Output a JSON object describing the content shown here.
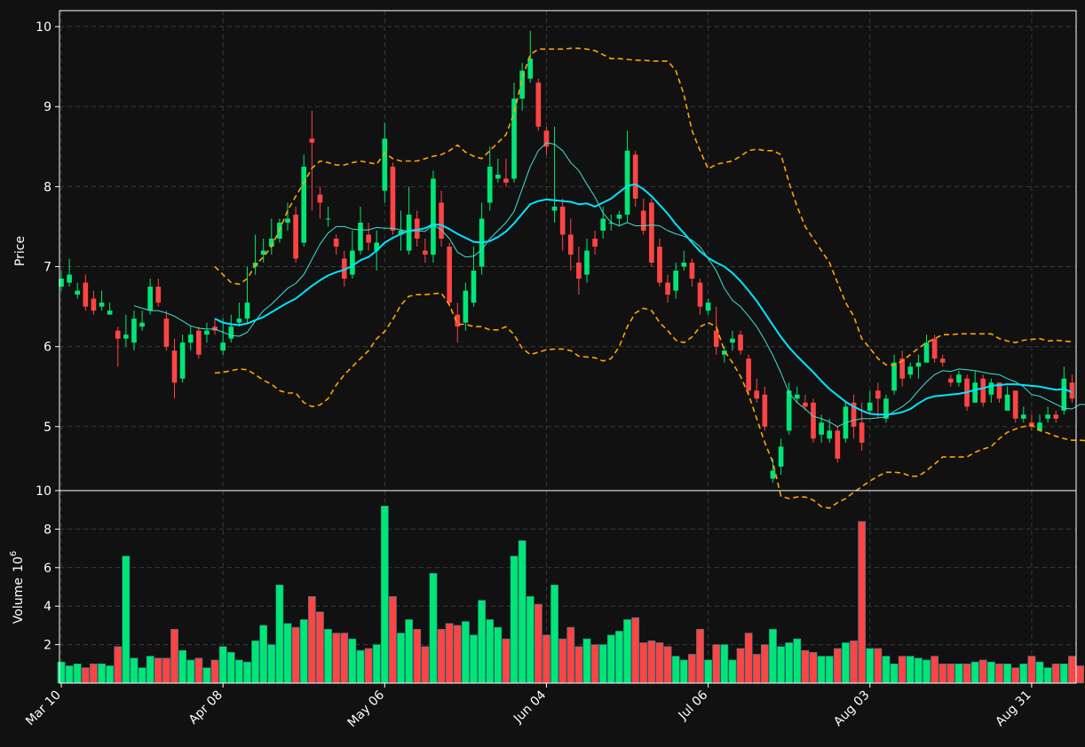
{
  "colors": {
    "background": "#111111",
    "up": "#00e676",
    "down": "#ff4444",
    "ma_slow": "#00e5ff",
    "ma_fast": "#40e0d0",
    "bands": "#ffa500",
    "grid": "#3a3a3a",
    "axis": "#ffffff"
  },
  "chart_data": [
    {
      "type": "candlestick",
      "panel": "price",
      "ylabel": "Price",
      "ylim": [
        4.2,
        10.2
      ],
      "yticks": [
        5,
        6,
        7,
        8,
        9,
        10
      ],
      "ytick_labels": [
        "5",
        "6",
        "7",
        "8",
        "9",
        "10"
      ],
      "x_dates": [
        "Mar 10",
        "Apr 08",
        "May 06",
        "Jun 04",
        "Jul 06",
        "Aug 03",
        "Aug 31"
      ],
      "x_index": [
        0,
        20,
        40,
        60,
        80,
        100,
        120
      ],
      "grid": true,
      "close": [
        6.85,
        6.9,
        6.7,
        6.5,
        6.45,
        6.55,
        6.45,
        6.1,
        6.15,
        6.35,
        6.3,
        6.75,
        6.55,
        6.0,
        5.55,
        6.05,
        6.15,
        5.9,
        6.2,
        6.2,
        6.05,
        6.25,
        6.35,
        6.55,
        7.05,
        7.2,
        7.35,
        7.55,
        7.6,
        7.1,
        8.25,
        8.55,
        7.8,
        7.6,
        7.25,
        6.85,
        7.2,
        7.55,
        7.3,
        7.3,
        8.6,
        7.45,
        7.45,
        7.65,
        7.35,
        7.15,
        8.1,
        7.35,
        6.55,
        6.25,
        6.7,
        6.95,
        7.6,
        8.25,
        8.15,
        8.05,
        9.1,
        9.45,
        9.6,
        8.75,
        8.5,
        7.75,
        7.4,
        7.15,
        6.85,
        7.2,
        7.25,
        7.6,
        7.55,
        7.65,
        8.45,
        7.85,
        7.45,
        7.05,
        6.8,
        6.65,
        6.95,
        7.05,
        6.85,
        6.5,
        6.55,
        6.0,
        5.95,
        6.1,
        5.95,
        5.45,
        5.35,
        5.0,
        4.45,
        4.75,
        5.45,
        5.4,
        5.25,
        4.85,
        5.05,
        4.95,
        4.6,
        5.25,
        5.0,
        4.8,
        5.3,
        5.35,
        5.35,
        5.8,
        5.6,
        5.75,
        5.8,
        6.05,
        5.85,
        5.8,
        5.55,
        5.65,
        5.25,
        5.55,
        5.3,
        5.55,
        5.35,
        5.4,
        5.1,
        5.15,
        5.0,
        5.05,
        5.15,
        5.1,
        5.6,
        5.35
      ],
      "open": [
        6.75,
        6.8,
        6.65,
        6.8,
        6.6,
        6.5,
        6.4,
        6.2,
        6.1,
        6.05,
        6.25,
        6.45,
        6.75,
        6.35,
        5.95,
        5.6,
        6.05,
        6.2,
        6.15,
        6.25,
        5.95,
        6.1,
        6.3,
        6.35,
        7.0,
        7.15,
        7.25,
        7.35,
        7.55,
        7.65,
        7.3,
        8.6,
        7.9,
        7.6,
        7.35,
        7.1,
        6.9,
        7.2,
        7.4,
        7.2,
        7.95,
        8.25,
        7.4,
        7.2,
        7.6,
        7.2,
        7.15,
        7.8,
        7.25,
        6.4,
        6.3,
        6.55,
        7.0,
        7.8,
        8.1,
        8.1,
        8.1,
        9.1,
        9.35,
        9.3,
        8.7,
        7.7,
        7.75,
        7.4,
        7.05,
        6.9,
        7.35,
        7.45,
        7.55,
        7.6,
        7.65,
        8.4,
        7.7,
        7.8,
        7.25,
        6.8,
        6.7,
        7.0,
        7.05,
        6.8,
        6.45,
        6.2,
        5.9,
        6.05,
        6.15,
        5.85,
        5.45,
        5.4,
        4.35,
        4.5,
        4.95,
        5.35,
        5.3,
        5.3,
        4.9,
        4.85,
        4.95,
        4.85,
        5.3,
        5.05,
        5.2,
        5.45,
        5.1,
        5.45,
        5.85,
        5.65,
        5.75,
        5.8,
        6.1,
        5.85,
        5.6,
        5.55,
        5.6,
        5.3,
        5.6,
        5.4,
        5.55,
        5.2,
        5.45,
        5.1,
        5.05,
        4.95,
        5.1,
        5.15,
        5.2,
        5.55
      ],
      "high": [
        6.95,
        7.1,
        6.8,
        6.9,
        6.7,
        6.7,
        6.55,
        6.25,
        6.4,
        6.45,
        6.45,
        6.85,
        6.85,
        6.45,
        6.1,
        6.15,
        6.25,
        6.25,
        6.3,
        6.35,
        6.35,
        6.4,
        6.55,
        7.0,
        7.4,
        7.35,
        7.6,
        7.6,
        7.8,
        7.75,
        8.4,
        8.95,
        8.0,
        7.75,
        7.4,
        7.2,
        7.45,
        7.75,
        7.55,
        7.45,
        8.8,
        8.3,
        7.7,
        8.0,
        7.7,
        7.35,
        8.2,
        7.95,
        7.3,
        6.55,
        6.8,
        7.25,
        7.8,
        8.5,
        8.35,
        8.35,
        9.3,
        9.55,
        9.95,
        9.35,
        8.75,
        8.75,
        7.85,
        7.6,
        7.25,
        7.35,
        7.45,
        7.75,
        7.65,
        7.7,
        8.7,
        8.45,
        7.85,
        7.85,
        7.35,
        6.9,
        7.05,
        7.2,
        7.1,
        6.85,
        6.6,
        6.5,
        6.0,
        6.2,
        6.2,
        5.9,
        5.6,
        5.5,
        4.6,
        4.85,
        5.55,
        5.5,
        5.4,
        5.35,
        5.15,
        5.1,
        5.0,
        5.3,
        5.4,
        5.3,
        5.45,
        5.55,
        5.4,
        5.9,
        5.95,
        5.8,
        5.9,
        6.15,
        6.15,
        5.9,
        5.65,
        5.7,
        5.65,
        5.7,
        5.65,
        5.6,
        5.55,
        5.5,
        5.25,
        5.25,
        5.15,
        5.15,
        5.25,
        5.2,
        5.75,
        5.65
      ],
      "low": [
        6.7,
        6.75,
        6.6,
        6.45,
        6.4,
        6.45,
        6.4,
        5.75,
        6.0,
        5.95,
        6.2,
        6.4,
        6.5,
        5.95,
        5.35,
        5.55,
        5.95,
        5.85,
        6.05,
        6.15,
        5.9,
        6.05,
        6.25,
        6.3,
        6.9,
        7.05,
        7.15,
        7.3,
        7.45,
        7.05,
        7.25,
        7.7,
        7.6,
        7.5,
        7.15,
        6.75,
        6.85,
        7.15,
        7.2,
        6.95,
        7.8,
        7.4,
        7.2,
        7.15,
        7.25,
        7.05,
        7.05,
        7.25,
        6.5,
        6.05,
        6.2,
        6.5,
        6.9,
        7.7,
        8.05,
        8.0,
        8.05,
        8.95,
        9.3,
        8.7,
        8.4,
        7.55,
        7.2,
        6.95,
        6.65,
        6.8,
        7.15,
        7.35,
        7.45,
        7.5,
        7.55,
        7.75,
        7.4,
        7.0,
        6.75,
        6.55,
        6.6,
        6.95,
        6.75,
        6.4,
        6.4,
        5.9,
        5.8,
        5.95,
        5.9,
        5.4,
        5.3,
        4.95,
        4.3,
        4.4,
        4.9,
        5.3,
        5.2,
        4.8,
        4.8,
        4.8,
        4.55,
        4.8,
        4.85,
        4.7,
        5.15,
        5.1,
        5.05,
        5.4,
        5.5,
        5.6,
        5.6,
        5.95,
        5.8,
        5.75,
        5.5,
        5.5,
        5.2,
        5.5,
        5.25,
        5.3,
        5.3,
        5.35,
        5.05,
        5.05,
        4.95,
        4.95,
        5.05,
        5.05,
        5.15,
        5.3
      ],
      "ma_slow": [
        null,
        null,
        null,
        null,
        null,
        null,
        null,
        null,
        null,
        null,
        null,
        null,
        null,
        null,
        null,
        null,
        null,
        null,
        null,
        6.35,
        6.3,
        6.28,
        6.27,
        6.29,
        6.33,
        6.37,
        6.43,
        6.49,
        6.55,
        6.6,
        6.68,
        6.76,
        6.83,
        6.89,
        6.93,
        6.96,
        7.01,
        7.08,
        7.12,
        7.2,
        7.3,
        7.36,
        7.41,
        7.45,
        7.46,
        7.48,
        7.53,
        7.52,
        7.47,
        7.41,
        7.36,
        7.31,
        7.3,
        7.32,
        7.37,
        7.44,
        7.54,
        7.66,
        7.78,
        7.82,
        7.84,
        7.83,
        7.82,
        7.81,
        7.78,
        7.79,
        7.75,
        7.8,
        7.85,
        7.93,
        8.01,
        8.03,
        7.97,
        7.88,
        7.77,
        7.66,
        7.53,
        7.42,
        7.3,
        7.19,
        7.11,
        7.05,
        7.0,
        6.92,
        6.82,
        6.7,
        6.57,
        6.42,
        6.27,
        6.12,
        5.99,
        5.88,
        5.78,
        5.68,
        5.57,
        5.47,
        5.39,
        5.31,
        5.25,
        5.2,
        5.16,
        5.15,
        5.15,
        5.16,
        5.18,
        5.22,
        5.29,
        5.35,
        5.38,
        5.39,
        5.4,
        5.41,
        5.43,
        5.46,
        5.48,
        5.51,
        5.52,
        5.53,
        5.53,
        5.52,
        5.51,
        5.5,
        5.48,
        5.46,
        5.47,
        5.43
      ],
      "ma_fast": [
        null,
        null,
        null,
        null,
        null,
        null,
        null,
        null,
        null,
        6.51,
        6.48,
        6.45,
        6.45,
        6.42,
        6.38,
        6.32,
        6.26,
        6.23,
        6.22,
        6.22,
        6.18,
        6.14,
        6.13,
        6.18,
        6.32,
        6.45,
        6.53,
        6.63,
        6.73,
        6.79,
        6.9,
        7.09,
        7.28,
        7.42,
        7.5,
        7.5,
        7.47,
        7.46,
        7.46,
        7.49,
        7.48,
        7.48,
        7.46,
        7.44,
        7.45,
        7.44,
        7.52,
        7.46,
        7.35,
        7.18,
        7.12,
        7.13,
        7.21,
        7.35,
        7.45,
        7.55,
        7.69,
        7.97,
        8.25,
        8.45,
        8.55,
        8.53,
        8.45,
        8.3,
        8.2,
        8.03,
        7.87,
        7.67,
        7.55,
        7.51,
        7.55,
        7.51,
        7.51,
        7.52,
        7.51,
        7.45,
        7.41,
        7.38,
        7.33,
        7.25,
        7.1,
        6.95,
        6.73,
        6.58,
        6.5,
        6.38,
        6.25,
        6.08,
        5.89,
        5.67,
        5.42,
        5.3,
        5.22,
        5.13,
        5.1,
        5.06,
        5.0,
        5.05,
        5.08,
        5.1,
        5.1,
        5.11,
        5.12,
        5.19,
        5.25,
        5.33,
        5.45,
        5.56,
        5.65,
        5.7,
        5.69,
        5.72,
        5.71,
        5.7,
        5.68,
        5.66,
        5.65,
        5.6,
        5.56,
        5.5,
        5.4,
        5.38,
        5.33,
        5.28,
        5.23,
        5.22,
        5.28,
        5.27
      ],
      "band_upper": [
        null,
        null,
        null,
        null,
        null,
        null,
        null,
        null,
        null,
        null,
        null,
        null,
        null,
        null,
        null,
        null,
        null,
        null,
        null,
        7.0,
        6.9,
        6.8,
        6.78,
        6.85,
        7.02,
        7.12,
        7.25,
        7.46,
        7.7,
        7.88,
        8.05,
        8.23,
        8.32,
        8.3,
        8.27,
        8.27,
        8.3,
        8.32,
        8.3,
        8.28,
        8.42,
        8.35,
        8.32,
        8.32,
        8.32,
        8.35,
        8.38,
        8.4,
        8.45,
        8.52,
        8.43,
        8.38,
        8.35,
        8.45,
        8.55,
        8.65,
        8.92,
        9.35,
        9.65,
        9.72,
        9.72,
        9.72,
        9.72,
        9.73,
        9.73,
        9.72,
        9.7,
        9.65,
        9.6,
        9.6,
        9.59,
        9.58,
        9.58,
        9.57,
        9.57,
        9.57,
        9.45,
        9.15,
        8.7,
        8.45,
        8.22,
        8.28,
        8.3,
        8.32,
        8.38,
        8.45,
        8.47,
        8.45,
        8.45,
        8.4,
        8.05,
        7.75,
        7.5,
        7.35,
        7.2,
        7.05,
        6.8,
        6.55,
        6.38,
        6.1,
        5.98,
        5.85,
        5.77,
        5.77,
        5.82,
        5.9,
        5.98,
        6.05,
        6.1,
        6.15,
        6.15,
        6.16,
        6.16,
        6.16,
        6.16,
        6.16,
        6.1,
        6.07,
        6.05,
        6.08,
        6.09,
        6.1,
        6.07,
        6.08,
        6.07,
        6.06
      ],
      "band_lower": [
        null,
        null,
        null,
        null,
        null,
        null,
        null,
        null,
        null,
        null,
        null,
        null,
        null,
        null,
        null,
        null,
        null,
        null,
        null,
        5.67,
        5.68,
        5.7,
        5.72,
        5.71,
        5.65,
        5.58,
        5.53,
        5.45,
        5.42,
        5.42,
        5.3,
        5.25,
        5.27,
        5.35,
        5.52,
        5.65,
        5.75,
        5.85,
        5.95,
        6.1,
        6.19,
        6.34,
        6.52,
        6.63,
        6.65,
        6.65,
        6.66,
        6.67,
        6.52,
        6.28,
        6.28,
        6.25,
        6.25,
        6.21,
        6.21,
        6.25,
        6.15,
        5.98,
        5.9,
        5.93,
        5.96,
        5.97,
        5.97,
        5.95,
        5.88,
        5.87,
        5.86,
        5.82,
        5.85,
        6.0,
        6.25,
        6.42,
        6.48,
        6.45,
        6.3,
        6.2,
        6.08,
        6.05,
        6.12,
        6.25,
        6.3,
        6.25,
        5.95,
        5.8,
        5.63,
        5.4,
        5.1,
        4.8,
        4.55,
        4.13,
        4.1,
        4.12,
        4.12,
        4.08,
        4.0,
        3.98,
        4.05,
        4.1,
        4.18,
        4.25,
        4.32,
        4.38,
        4.43,
        4.43,
        4.42,
        4.38,
        4.38,
        4.45,
        4.53,
        4.62,
        4.62,
        4.62,
        4.62,
        4.68,
        4.72,
        4.75,
        4.85,
        4.93,
        4.97,
        5.0,
        5.02,
        4.95,
        4.92,
        4.88,
        4.85,
        4.83,
        4.83,
        4.82
      ]
    },
    {
      "type": "bar",
      "panel": "volume",
      "ylabel": "Volume",
      "ylabel_exponent": "10",
      "ylabel_exponent_power": "6",
      "ylim": [
        0,
        10
      ],
      "yticks": [
        2,
        4,
        6,
        8,
        10
      ],
      "ytick_labels": [
        "2",
        "4",
        "6",
        "8",
        "10"
      ],
      "grid": true,
      "values": [
        1.1,
        0.9,
        1.0,
        0.8,
        1.0,
        1.0,
        0.9,
        1.9,
        6.6,
        1.3,
        0.8,
        1.4,
        1.3,
        1.3,
        2.8,
        1.7,
        1.2,
        1.3,
        0.8,
        1.2,
        1.9,
        1.6,
        1.2,
        1.1,
        2.2,
        3.0,
        2.0,
        5.1,
        3.1,
        2.9,
        3.3,
        4.5,
        3.7,
        2.8,
        2.6,
        2.6,
        2.3,
        1.7,
        1.8,
        2.0,
        9.2,
        4.5,
        2.6,
        3.3,
        2.8,
        1.9,
        5.7,
        2.8,
        3.1,
        3.0,
        3.2,
        2.5,
        4.3,
        3.3,
        2.9,
        2.3,
        6.6,
        7.4,
        4.5,
        4.1,
        2.5,
        5.1,
        2.3,
        2.9,
        1.9,
        2.3,
        2.0,
        2.0,
        2.5,
        2.7,
        3.3,
        3.4,
        2.1,
        2.2,
        2.1,
        1.9,
        1.4,
        1.2,
        1.5,
        2.8,
        1.2,
        2.0,
        2.0,
        1.2,
        1.8,
        2.6,
        1.5,
        2.0,
        2.8,
        1.9,
        2.1,
        2.3,
        1.7,
        1.6,
        1.4,
        1.4,
        1.8,
        2.1,
        2.2,
        8.4,
        1.8,
        1.8,
        1.4,
        1.0,
        1.4,
        1.4,
        1.3,
        1.2,
        1.4,
        1.0,
        1.0,
        1.0,
        1.0,
        1.1,
        1.2,
        1.1,
        1.0,
        1.0,
        0.8,
        1.0,
        1.4,
        1.1,
        0.8,
        1.0,
        1.0,
        1.4,
        0.9
      ]
    }
  ]
}
